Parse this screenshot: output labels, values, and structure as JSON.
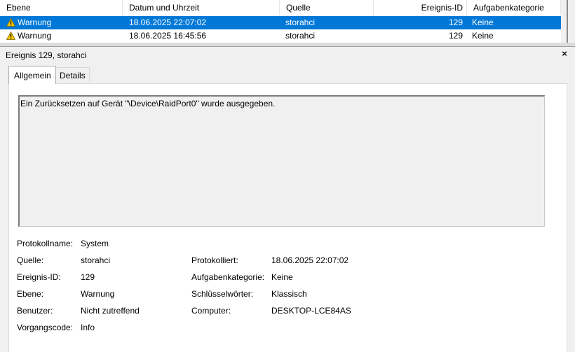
{
  "columns": [
    "Ebene",
    "Datum und Uhrzeit",
    "Quelle",
    "Ereignis-ID",
    "Aufgabenkategorie"
  ],
  "rows": [
    {
      "level": "Warnung",
      "datetime": "18.06.2025 22:07:02",
      "source": "storahci",
      "id": "129",
      "category": "Keine",
      "selected": true
    },
    {
      "level": "Warnung",
      "datetime": "18.06.2025 16:45:56",
      "source": "storahci",
      "id": "129",
      "category": "Keine",
      "selected": false
    }
  ],
  "pane": {
    "title": "Ereignis 129, storahci",
    "close": "×"
  },
  "tabs": {
    "general": "Allgemein",
    "details": "Details"
  },
  "message": "Ein Zurücksetzen auf Gerät \"\\Device\\RaidPort0\" wurde ausgegeben.",
  "fields": {
    "log_label": "Protokollname:",
    "log_value": "System",
    "source_label": "Quelle:",
    "source_value": "storahci",
    "logged_label": "Protokolliert:",
    "logged_value": "18.06.2025 22:07:02",
    "eventid_label": "Ereignis-ID:",
    "eventid_value": "129",
    "category_label": "Aufgabenkategorie:",
    "category_value": "Keine",
    "level_label": "Ebene:",
    "level_value": "Warnung",
    "keywords_label": "Schlüsselwörter:",
    "keywords_value": "Klassisch",
    "user_label": "Benutzer:",
    "user_value": "Nicht zutreffend",
    "computer_label": "Computer:",
    "computer_value": "DESKTOP-LCE84AS",
    "opcode_label": "Vorgangscode:",
    "opcode_value": "Info"
  },
  "colors": {
    "selection": "#0078d7",
    "warning": "#f5c400"
  },
  "icons": {
    "warning": "warning-triangle-icon",
    "close": "close-icon"
  }
}
